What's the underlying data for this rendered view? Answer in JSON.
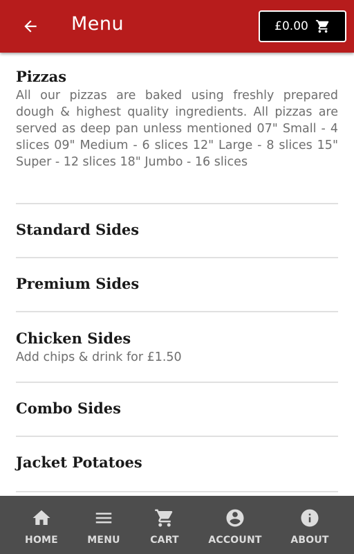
{
  "header": {
    "title": "Menu",
    "back_icon": "arrow-left-icon",
    "cart_total": "£0.00",
    "cart_icon": "shopping-cart-icon",
    "background_color": "#b71c1c"
  },
  "categories": [
    {
      "title": "Pizzas",
      "description": "All our pizzas are baked using freshly prepared dough & highest quality ingredients. All pizzas are served as deep pan unless mentioned 07\" Small - 4 slices 09\" Medium - 6 slices 12\" Large - 8 slices 15\" Super - 12 slices 18\" Jumbo - 16 slices"
    },
    {
      "title": "Standard Sides"
    },
    {
      "title": "Premium Sides"
    },
    {
      "title": "Chicken Sides",
      "description": "Add chips & drink for £1.50"
    },
    {
      "title": "Combo Sides"
    },
    {
      "title": "Jacket Potatoes"
    }
  ],
  "bottom_nav": {
    "background_color": "#4d4d4d",
    "items": [
      {
        "label": "HOME",
        "icon": "home-icon"
      },
      {
        "label": "MENU",
        "icon": "menu-icon"
      },
      {
        "label": "CART",
        "icon": "cart-icon"
      },
      {
        "label": "ACCOUNT",
        "icon": "account-icon"
      },
      {
        "label": "ABOUT",
        "icon": "info-icon"
      }
    ]
  }
}
